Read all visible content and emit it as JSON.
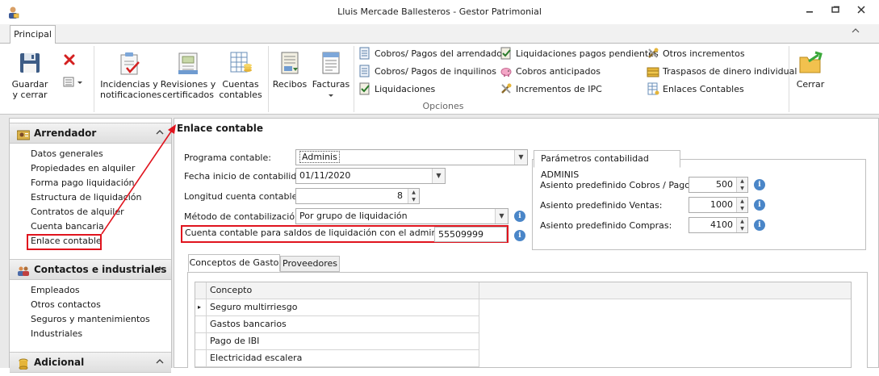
{
  "window": {
    "title": "Lluis Mercade Ballesteros - Gestor Patrimonial",
    "controls": [
      "minimize",
      "restore",
      "close"
    ]
  },
  "ribbon": {
    "tabs": [
      {
        "label": "Principal",
        "active": true
      }
    ],
    "buttons": {
      "save_close": "Guardar y cerrar",
      "save_line1": "Guardar",
      "save_line2": "y cerrar",
      "incidencias_1": "Incidencias y",
      "incidencias_2": "notificaciones",
      "revisiones_1": "Revisiones y",
      "revisiones_2": "certificados",
      "cuentas_1": "Cuentas",
      "cuentas_2": "contables",
      "recibos": "Recibos",
      "facturas": "Facturas",
      "cerrar": "Cerrar"
    },
    "small_buttons": {
      "col1": [
        "Cobros/ Pagos del arrendador",
        "Cobros/ Pagos de inquilinos",
        "Liquidaciones"
      ],
      "col2": [
        "Liquidaciones pagos pendientes",
        "Cobros anticipados",
        "Incrementos de IPC"
      ],
      "col3": [
        "Otros incrementos",
        "Traspasos de dinero individual",
        "Enlaces Contables"
      ]
    },
    "group_caption": "Opciones"
  },
  "nav": {
    "arrendador": {
      "header": "Arrendador",
      "items": [
        "Datos generales",
        "Propiedades en alquiler",
        "Forma pago liquidación",
        "Estructura de liquidación",
        "Contratos de alquiler",
        "Cuenta bancaria",
        "Enlace contable"
      ],
      "selected": "Enlace contable"
    },
    "contactos": {
      "header": "Contactos e industriales",
      "items": [
        "Empleados",
        "Otros contactos",
        "Seguros y mantenimientos",
        "Industriales"
      ]
    },
    "adicional": {
      "header": "Adicional"
    }
  },
  "form": {
    "section_title": "Enlace contable",
    "programa": {
      "label": "Programa contable:",
      "value": "Adminis"
    },
    "fecha": {
      "label": "Fecha inicio de contabilidad:",
      "value": "01/11/2020"
    },
    "longitud": {
      "label": "Longitud cuenta contable:",
      "value": "8"
    },
    "metodo": {
      "label": "Método de contabilización:",
      "value": "Por grupo de liquidación"
    },
    "cuenta_saldos": {
      "label": "Cuenta contable para saldos de liquidación con el administrador",
      "value": "55509999"
    }
  },
  "params": {
    "tab": "Parámetros contabilidad ADMINIS",
    "cobros": {
      "label": "Asiento  predefinido Cobros / Pagos:",
      "value": "500"
    },
    "ventas": {
      "label": "Asiento  predefinido Ventas:",
      "value": "1000"
    },
    "compras": {
      "label": "Asiento predefinido Compras:",
      "value": "4100"
    }
  },
  "bottom_tabs": [
    {
      "label": "Conceptos de Gasto",
      "active": true
    },
    {
      "label": "Proveedores",
      "active": false
    }
  ],
  "grid": {
    "header": "Concepto",
    "rows": [
      "Seguro multirriesgo",
      "Gastos bancarios",
      "Pago de IBI",
      "Electricidad escalera"
    ]
  },
  "colors": {
    "highlight_red": "#e0141e",
    "info_blue": "#4a86c8",
    "workspace_gray": "#e9e9e9"
  }
}
